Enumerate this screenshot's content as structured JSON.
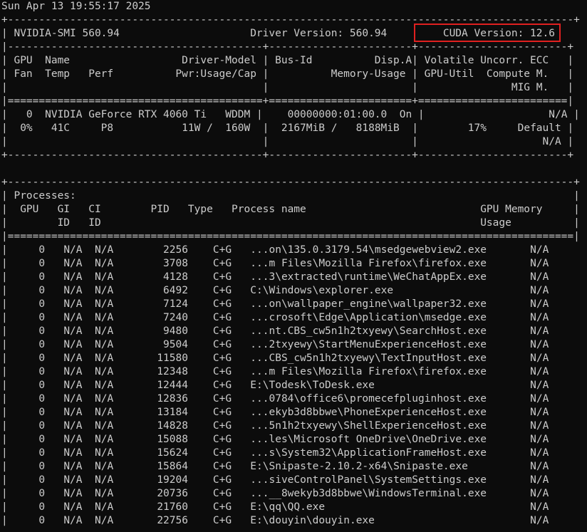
{
  "timestamp": "Sun Apr 13 19:55:17 2025",
  "header": {
    "smi_label": "NVIDIA-SMI 560.94",
    "driver_label": "Driver Version: 560.94",
    "cuda_label": "CUDA Version: 12.6"
  },
  "gpu_table": {
    "header_rows": [
      [
        "GPU  Name                  Driver-Model",
        "Bus-Id          Disp.A",
        "Volatile Uncorr. ECC"
      ],
      [
        "Fan  Temp   Perf          Pwr:Usage/Cap",
        "         Memory-Usage",
        "GPU-Util  Compute M."
      ],
      [
        "",
        "",
        "              MIG M."
      ]
    ],
    "rows": [
      {
        "index": "0",
        "name": "NVIDIA GeForce RTX 4060 Ti",
        "driver_model": "WDDM",
        "bus_id": "00000000:01:00.0",
        "disp": "On",
        "ecc": "N/A",
        "fan": "0%",
        "temp": "41C",
        "perf": "P8",
        "power": "11W /  160W",
        "memory": "2167MiB /   8188MiB",
        "util": "17%",
        "compute": "Default",
        "mig": "N/A"
      }
    ]
  },
  "processes": {
    "title": "Processes:",
    "header_line1": "GPU   GI   CI        PID   Type   Process name                            GPU Memory",
    "header_line2": "      ID   ID                                                             Usage",
    "rows": [
      {
        "gpu": "0",
        "gi": "N/A",
        "ci": "N/A",
        "pid": "2256",
        "type": "C+G",
        "name": "...on\\135.0.3179.54\\msedgewebview2.exe",
        "mem": "N/A"
      },
      {
        "gpu": "0",
        "gi": "N/A",
        "ci": "N/A",
        "pid": "3708",
        "type": "C+G",
        "name": "...m Files\\Mozilla Firefox\\firefox.exe",
        "mem": "N/A"
      },
      {
        "gpu": "0",
        "gi": "N/A",
        "ci": "N/A",
        "pid": "4128",
        "type": "C+G",
        "name": "...3\\extracted\\runtime\\WeChatAppEx.exe",
        "mem": "N/A"
      },
      {
        "gpu": "0",
        "gi": "N/A",
        "ci": "N/A",
        "pid": "6492",
        "type": "C+G",
        "name": "C:\\Windows\\explorer.exe",
        "mem": "N/A"
      },
      {
        "gpu": "0",
        "gi": "N/A",
        "ci": "N/A",
        "pid": "7124",
        "type": "C+G",
        "name": "...on\\wallpaper_engine\\wallpaper32.exe",
        "mem": "N/A"
      },
      {
        "gpu": "0",
        "gi": "N/A",
        "ci": "N/A",
        "pid": "7240",
        "type": "C+G",
        "name": "...crosoft\\Edge\\Application\\msedge.exe",
        "mem": "N/A"
      },
      {
        "gpu": "0",
        "gi": "N/A",
        "ci": "N/A",
        "pid": "9480",
        "type": "C+G",
        "name": "...nt.CBS_cw5n1h2txyewy\\SearchHost.exe",
        "mem": "N/A"
      },
      {
        "gpu": "0",
        "gi": "N/A",
        "ci": "N/A",
        "pid": "9504",
        "type": "C+G",
        "name": "...2txyewy\\StartMenuExperienceHost.exe",
        "mem": "N/A"
      },
      {
        "gpu": "0",
        "gi": "N/A",
        "ci": "N/A",
        "pid": "11580",
        "type": "C+G",
        "name": "...CBS_cw5n1h2txyewy\\TextInputHost.exe",
        "mem": "N/A"
      },
      {
        "gpu": "0",
        "gi": "N/A",
        "ci": "N/A",
        "pid": "12348",
        "type": "C+G",
        "name": "...m Files\\Mozilla Firefox\\firefox.exe",
        "mem": "N/A"
      },
      {
        "gpu": "0",
        "gi": "N/A",
        "ci": "N/A",
        "pid": "12444",
        "type": "C+G",
        "name": "E:\\Todesk\\ToDesk.exe",
        "mem": "N/A"
      },
      {
        "gpu": "0",
        "gi": "N/A",
        "ci": "N/A",
        "pid": "12836",
        "type": "C+G",
        "name": "...0784\\office6\\promecefpluginhost.exe",
        "mem": "N/A"
      },
      {
        "gpu": "0",
        "gi": "N/A",
        "ci": "N/A",
        "pid": "13184",
        "type": "C+G",
        "name": "...ekyb3d8bbwe\\PhoneExperienceHost.exe",
        "mem": "N/A"
      },
      {
        "gpu": "0",
        "gi": "N/A",
        "ci": "N/A",
        "pid": "14828",
        "type": "C+G",
        "name": "...5n1h2txyewy\\ShellExperienceHost.exe",
        "mem": "N/A"
      },
      {
        "gpu": "0",
        "gi": "N/A",
        "ci": "N/A",
        "pid": "15088",
        "type": "C+G",
        "name": "...les\\Microsoft OneDrive\\OneDrive.exe",
        "mem": "N/A"
      },
      {
        "gpu": "0",
        "gi": "N/A",
        "ci": "N/A",
        "pid": "15624",
        "type": "C+G",
        "name": "...s\\System32\\ApplicationFrameHost.exe",
        "mem": "N/A"
      },
      {
        "gpu": "0",
        "gi": "N/A",
        "ci": "N/A",
        "pid": "15864",
        "type": "C+G",
        "name": "E:\\Snipaste-2.10.2-x64\\Snipaste.exe",
        "mem": "N/A"
      },
      {
        "gpu": "0",
        "gi": "N/A",
        "ci": "N/A",
        "pid": "19204",
        "type": "C+G",
        "name": "...siveControlPanel\\SystemSettings.exe",
        "mem": "N/A"
      },
      {
        "gpu": "0",
        "gi": "N/A",
        "ci": "N/A",
        "pid": "20736",
        "type": "C+G",
        "name": "...__8wekyb3d8bbwe\\WindowsTerminal.exe",
        "mem": "N/A"
      },
      {
        "gpu": "0",
        "gi": "N/A",
        "ci": "N/A",
        "pid": "21760",
        "type": "C+G",
        "name": "E:\\qq\\QQ.exe",
        "mem": "N/A"
      },
      {
        "gpu": "0",
        "gi": "N/A",
        "ci": "N/A",
        "pid": "22756",
        "type": "C+G",
        "name": "E:\\douyin\\douyin.exe",
        "mem": "N/A"
      }
    ]
  },
  "colors": {
    "background": "#0c0c0c",
    "text": "#cccccc",
    "highlight": "#e02020"
  }
}
